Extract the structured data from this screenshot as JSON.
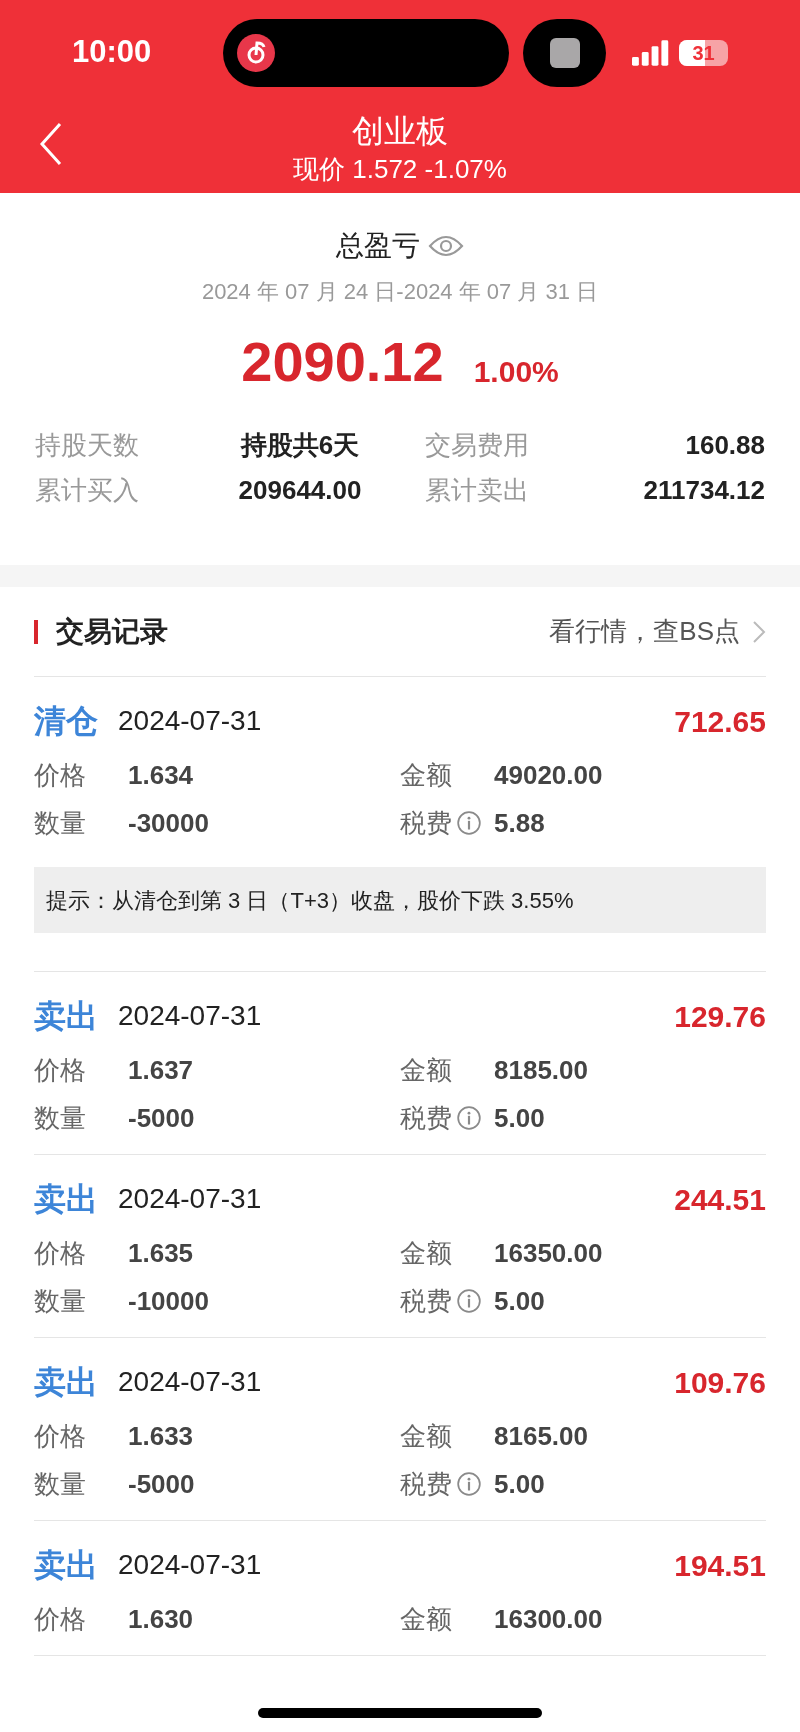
{
  "status_bar": {
    "time": "10:00",
    "battery": "31"
  },
  "header": {
    "title": "创业板",
    "subtitle": "现价 1.572 -1.07%"
  },
  "summary": {
    "title": "总盈亏",
    "date_range": "2024 年 07 月 24 日-2024 年 07 月 31 日",
    "profit": "2090.12",
    "percent": "1.00%",
    "stats": [
      {
        "label": "持股天数",
        "value": "持股共6天"
      },
      {
        "label": "交易费用",
        "value": "160.88"
      },
      {
        "label": "累计买入",
        "value": "209644.00"
      },
      {
        "label": "累计卖出",
        "value": "211734.12"
      }
    ]
  },
  "records": {
    "title": "交易记录",
    "link": "看行情，查BS点",
    "items": [
      {
        "type": "清仓",
        "date": "2024-07-31",
        "profit": "712.65",
        "rows": [
          [
            {
              "label": "价格",
              "value": "1.634",
              "info": false
            },
            {
              "label": "金额",
              "value": "49020.00",
              "info": false
            }
          ],
          [
            {
              "label": "数量",
              "value": "-30000",
              "info": false
            },
            {
              "label": "税费",
              "value": "5.88",
              "info": true
            }
          ]
        ],
        "tip": "提示：从清仓到第 3 日（T+3）收盘，股价下跌 3.55%"
      },
      {
        "type": "卖出",
        "date": "2024-07-31",
        "profit": "129.76",
        "rows": [
          [
            {
              "label": "价格",
              "value": "1.637",
              "info": false
            },
            {
              "label": "金额",
              "value": "8185.00",
              "info": false
            }
          ],
          [
            {
              "label": "数量",
              "value": "-5000",
              "info": false
            },
            {
              "label": "税费",
              "value": "5.00",
              "info": true
            }
          ]
        ]
      },
      {
        "type": "卖出",
        "date": "2024-07-31",
        "profit": "244.51",
        "rows": [
          [
            {
              "label": "价格",
              "value": "1.635",
              "info": false
            },
            {
              "label": "金额",
              "value": "16350.00",
              "info": false
            }
          ],
          [
            {
              "label": "数量",
              "value": "-10000",
              "info": false
            },
            {
              "label": "税费",
              "value": "5.00",
              "info": true
            }
          ]
        ]
      },
      {
        "type": "卖出",
        "date": "2024-07-31",
        "profit": "109.76",
        "rows": [
          [
            {
              "label": "价格",
              "value": "1.633",
              "info": false
            },
            {
              "label": "金额",
              "value": "8165.00",
              "info": false
            }
          ],
          [
            {
              "label": "数量",
              "value": "-5000",
              "info": false
            },
            {
              "label": "税费",
              "value": "5.00",
              "info": true
            }
          ]
        ]
      },
      {
        "type": "卖出",
        "date": "2024-07-31",
        "profit": "194.51",
        "rows": [
          [
            {
              "label": "价格",
              "value": "1.630",
              "info": false
            },
            {
              "label": "金额",
              "value": "16300.00",
              "info": false
            }
          ]
        ]
      }
    ]
  }
}
